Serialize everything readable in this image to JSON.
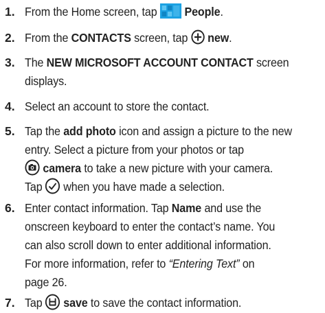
{
  "steps": [
    {
      "number": "1.",
      "lines": [
        {
          "pre": "From the Home screen, tap ",
          "icon": "people-tile-icon",
          "bold": "People",
          "post": "."
        }
      ]
    },
    {
      "number": "2.",
      "lines": [
        {
          "pre": "From the ",
          "bold": "CONTACTS",
          "mid": " screen, tap ",
          "icon": "add-circle-icon",
          "bold2": "new",
          "post": "."
        }
      ]
    },
    {
      "number": "3.",
      "lines": [
        {
          "pre": "The ",
          "bold": "NEW MICROSOFT ACCOUNT CONTACT",
          "post": " screen"
        },
        {
          "text": "displays."
        }
      ]
    },
    {
      "number": "4.",
      "lines": [
        {
          "text": "Select an account to store the contact."
        }
      ]
    },
    {
      "number": "5.",
      "lines": [
        {
          "pre": "Tap the ",
          "bold": "add photo",
          "post": " icon and assign a picture to the new"
        },
        {
          "text": "entry. Select a picture from your photos or tap"
        },
        {
          "icon": "camera-circle-icon",
          "bold": "camera",
          "post": " to take a new picture with your camera."
        },
        {
          "pre": "Tap ",
          "icon": "checkmark-circle-icon",
          "post": " when you have made a selection."
        }
      ]
    },
    {
      "number": "6.",
      "lines": [
        {
          "pre": "Enter contact information. Tap ",
          "bold": "Name",
          "post": " and use the"
        },
        {
          "text": "onscreen keyboard to enter the contact’s name. You"
        },
        {
          "text": "can also scroll down to enter additional information."
        },
        {
          "pre": "For more information, refer to ",
          "italic": "“Entering Text”",
          "post": " on"
        },
        {
          "text": "page 26."
        }
      ]
    },
    {
      "number": "7.",
      "lines": [
        {
          "pre": "Tap ",
          "icon": "save-circle-icon",
          "bold": "save",
          "post": " to save the contact information."
        }
      ]
    }
  ],
  "colors": {
    "text": "#222222",
    "people_tile": "#1ba1e2",
    "icon_stroke": "#222222"
  }
}
